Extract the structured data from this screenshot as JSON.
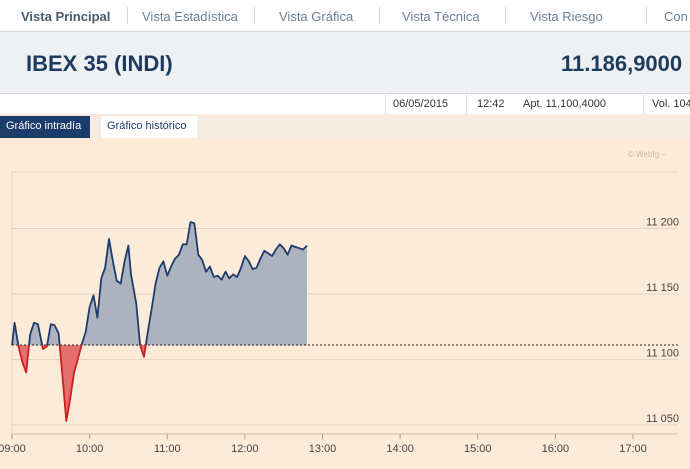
{
  "nav": {
    "tabs": [
      {
        "label": "Vista Principal",
        "active": true
      },
      {
        "label": "Vista Estadística",
        "active": false
      },
      {
        "label": "Vista Gráfica",
        "active": false
      },
      {
        "label": "Vista Técnica",
        "active": false
      },
      {
        "label": "Vista Riesgo",
        "active": false
      },
      {
        "label": "Con",
        "active": false
      }
    ]
  },
  "header": {
    "title": "IBEX 35 (INDI)",
    "price": "11.186,9000"
  },
  "info": {
    "date": "06/05/2015",
    "time": "12:42",
    "apertura": "Apt. 11.100,4000",
    "volumen": "Vol. 104"
  },
  "subtabs": {
    "intradia": "Gráfico intradía",
    "historico": "Gráfico histórico"
  },
  "watermark": "© Webfg –",
  "colors": {
    "nav_text": "#6d7e92",
    "title": "#1c3c5f",
    "line": "#1c3c6b",
    "area_up": "#a9b0bd",
    "area_down": "#e06060",
    "negative_line": "#cc1f1f",
    "chart_bg": "#fdebd9"
  },
  "chart_data": {
    "type": "area",
    "xlabel": "",
    "ylabel": "",
    "reference_value": 11111,
    "ylim": [
      11040,
      11260
    ],
    "y_ticks": [
      {
        "value": 11050,
        "label": "11 050"
      },
      {
        "value": 11100,
        "label": "11 100"
      },
      {
        "value": 11150,
        "label": "11 150"
      },
      {
        "value": 11200,
        "label": "11 200"
      }
    ],
    "x_ticks": [
      "09:00",
      "10:00",
      "11:00",
      "12:00",
      "13:00",
      "14:00",
      "15:00",
      "16:00",
      "17:00"
    ],
    "x_range_minutes": [
      540,
      1020
    ],
    "grid": true,
    "series": [
      {
        "x_minutes": [
          540,
          542,
          545,
          548,
          551,
          554,
          557,
          560,
          564,
          567,
          570,
          573,
          576,
          579,
          582,
          585,
          588,
          590,
          594,
          597,
          600,
          603,
          606,
          609,
          612,
          615,
          618,
          621,
          624,
          627,
          630,
          632,
          636,
          639,
          642,
          645,
          648,
          651,
          654,
          657,
          660,
          663,
          666,
          669,
          672,
          675,
          678,
          681,
          684,
          687,
          690,
          693,
          696,
          699,
          702,
          705,
          708,
          711,
          714,
          717,
          720,
          723,
          726,
          729,
          732,
          735,
          738,
          741,
          744,
          747,
          750,
          753,
          756,
          759,
          762,
          765,
          768
        ],
        "values": [
          11111,
          11128,
          11110,
          11098,
          11090,
          11119,
          11128,
          11127,
          11108,
          11110,
          11127,
          11126,
          11120,
          11087,
          11053,
          11070,
          11090,
          11097,
          11112,
          11121,
          11140,
          11149,
          11132,
          11162,
          11170,
          11192,
          11175,
          11160,
          11158,
          11175,
          11187,
          11165,
          11143,
          11111,
          11102,
          11121,
          11139,
          11158,
          11170,
          11175,
          11164,
          11171,
          11177,
          11180,
          11188,
          11188,
          11205,
          11204,
          11180,
          11176,
          11167,
          11171,
          11163,
          11164,
          11161,
          11167,
          11162,
          11165,
          11163,
          11170,
          11179,
          11175,
          11169,
          11170,
          11177,
          11183,
          11181,
          11179,
          11184,
          11188,
          11185,
          11180,
          11187,
          11186,
          11185,
          11184,
          11187
        ]
      }
    ]
  }
}
